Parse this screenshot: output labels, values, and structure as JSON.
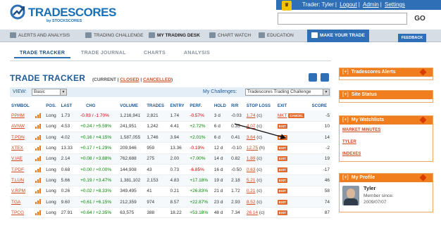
{
  "logo": {
    "brand_left": "TRADE",
    "brand_right": "SCORES",
    "tagline": "by STOCKSCORES"
  },
  "topbar": {
    "greeting": "Trader: Tyler",
    "links": [
      "Logout",
      "Admin",
      "Settings"
    ],
    "go_label": "GO"
  },
  "nav": {
    "items": [
      "ALERTS AND ANALYSIS",
      "TRADING CHALLENGE",
      "MY TRADING DESK",
      "CHART WATCH",
      "EDUCATION",
      "MAKE YOUR TRADE"
    ],
    "feedback": "FEEDBACK"
  },
  "subtabs": [
    "TRADE TRACKER",
    "TRADE JOURNAL",
    "CHARTS",
    "ANALYSIS"
  ],
  "tracker": {
    "title": "TRADE TRACKER",
    "filter_open": "(",
    "filter_current": "CURRENT",
    "filter_closed": "CLOSED",
    "filter_cancelled": "CANCELLED",
    "filter_close": ")",
    "sep": "|"
  },
  "viewbar": {
    "view_label": "VIEW:",
    "view_value": "Basic",
    "challenges_label": "My Challenges:",
    "challenge_value": "Tradescores Trading Challenge"
  },
  "columns": [
    "SYMBOL",
    "POS.",
    "LAST",
    "CHG",
    "VOLUME",
    "TRADES",
    "ENTRY",
    "PERF.",
    "HOLD",
    "R/R",
    "STOP LOSS",
    "EXIT",
    "SCORE"
  ],
  "rows": [
    {
      "symbol": "PPHM",
      "pos": "Long",
      "last": "1.73",
      "chg": "-0.03 / -1.70%",
      "chg_dir": "neg",
      "volume": "1,216,941",
      "trades": "2,821",
      "entry": "1.74",
      "perf": "-0.57%",
      "perf_dir": "neg",
      "hold": "3 d",
      "rr": "-0.03",
      "stop": "1.74",
      "stop_suffix": "(c)",
      "exit": "MKT",
      "exit_badge": "CANCEL",
      "score": "-5"
    },
    {
      "symbol": "AVNW",
      "pos": "Long",
      "last": "4.53",
      "chg": "+0.24 / +5.59%",
      "chg_dir": "pos",
      "volume": "241,951",
      "trades": "1,242",
      "entry": "4.41",
      "perf": "+2.72%",
      "perf_dir": "pos",
      "hold": "6 d",
      "rr": "0.35",
      "stop": "4.07",
      "stop_suffix": "(c)",
      "exit": "",
      "exit_badge": "EXIT",
      "score": "10"
    },
    {
      "symbol": "T.PDN",
      "pos": "Long",
      "last": "4.02",
      "chg": "+0.16 / +4.15%",
      "chg_dir": "pos",
      "volume": "1,587,055",
      "trades": "1,746",
      "entry": "3.94",
      "perf": "+2.01%",
      "perf_dir": "pos",
      "hold": "6 d",
      "rr": "0.41",
      "stop": "3.64",
      "stop_suffix": "(c)",
      "exit": "",
      "exit_badge": "EXIT",
      "score": "14"
    },
    {
      "symbol": "XTEX",
      "pos": "Long",
      "last": "13.33",
      "chg": "+0.17 / +1.29%",
      "chg_dir": "pos",
      "volume": "209,946",
      "trades": "959",
      "entry": "13.36",
      "perf": "-0.19%",
      "perf_dir": "neg",
      "hold": "12 d",
      "rr": "-0.10",
      "stop": "12.75",
      "stop_suffix": "(h)",
      "exit": "",
      "exit_badge": "EXIT",
      "score": "-2"
    },
    {
      "symbol": "V.IAE",
      "pos": "Long",
      "last": "2.14",
      "chg": "+0.08 / +3.88%",
      "chg_dir": "pos",
      "volume": "762,688",
      "trades": "275",
      "entry": "2.00",
      "perf": "+7.00%",
      "perf_dir": "pos",
      "hold": "14 d",
      "rr": "0.82",
      "stop": "1.89",
      "stop_suffix": "(c)",
      "exit": "",
      "exit_badge": "EXIT",
      "score": "19"
    },
    {
      "symbol": "T.PDF",
      "pos": "Long",
      "last": "0.68",
      "chg": "+0.00 / +0.00%",
      "chg_dir": "pos",
      "volume": "144,908",
      "trades": "43",
      "entry": "0.73",
      "perf": "-6.85%",
      "perf_dir": "neg",
      "hold": "16 d",
      "rr": "-0.50",
      "stop": "0.63",
      "stop_suffix": "(c)",
      "exit": "",
      "exit_badge": "EXIT",
      "score": "-17"
    },
    {
      "symbol": "T.LUN",
      "pos": "Long",
      "last": "5.66",
      "chg": "+0.19 / +3.47%",
      "chg_dir": "pos",
      "volume": "1,381,102",
      "trades": "2,153",
      "entry": "4.83",
      "perf": "+17.18%",
      "perf_dir": "pos",
      "hold": "19 d",
      "rr": "2.18",
      "stop": "5.21",
      "stop_suffix": "(c)",
      "exit": "",
      "exit_badge": "EXIT",
      "score": "46"
    },
    {
      "symbol": "V.RPM",
      "pos": "Long",
      "last": "0.26",
      "chg": "+0.02 / +8.33%",
      "chg_dir": "pos",
      "volume": "349,495",
      "trades": "41",
      "entry": "0.21",
      "perf": "+26.83%",
      "perf_dir": "pos",
      "hold": "21 d",
      "rr": "1.72",
      "stop": "0.21",
      "stop_suffix": "(c)",
      "exit": "",
      "exit_badge": "EXIT",
      "score": "58"
    },
    {
      "symbol": "TGA",
      "pos": "Long",
      "last": "9.60",
      "chg": "+0.61 / +6.15%",
      "chg_dir": "pos",
      "volume": "212,359",
      "trades": "974",
      "entry": "8.57",
      "perf": "+22.87%",
      "perf_dir": "pos",
      "hold": "23 d",
      "rr": "2.93",
      "stop": "8.52",
      "stop_suffix": "(c)",
      "exit": "",
      "exit_badge": "EXIT",
      "score": "74"
    },
    {
      "symbol": "TPCG",
      "pos": "Long",
      "last": "27.91",
      "chg": "+0.64 / +2.35%",
      "chg_dir": "pos",
      "volume": "63,575",
      "trades": "388",
      "entry": "18.22",
      "perf": "+53.18%",
      "perf_dir": "pos",
      "hold": "48 d",
      "rr": "7.34",
      "stop": "26.14",
      "stop_suffix": "(c)",
      "exit": "",
      "exit_badge": "EXIT",
      "score": "87"
    }
  ],
  "sidebar": {
    "bracket": "[+]",
    "alerts_title": "Tradescores Alerts",
    "status_title": "Site Status",
    "watchlists_title": "My Watchlists",
    "watchlists": [
      "MARKET MINUTES",
      "TYLER",
      "INDEXES"
    ],
    "profile_title": "My Profile",
    "profile_name": "Tyler",
    "member_since_label": "Member since:",
    "member_since": "2009/07/07"
  },
  "colors": {
    "brand_blue": "#2f6fb5",
    "orange": "#f07d1e",
    "link_orange": "#d04a20",
    "positive": "#008800",
    "negative": "#cc0000"
  }
}
